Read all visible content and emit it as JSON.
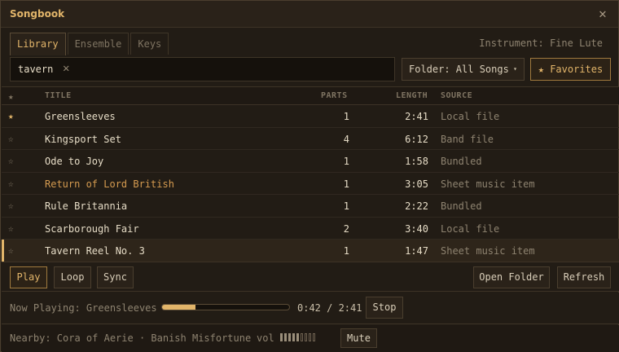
{
  "window": {
    "title": "Songbook",
    "close_icon": "close-icon"
  },
  "tabs": [
    {
      "label": "Library",
      "active": true
    },
    {
      "label": "Ensemble",
      "active": false
    },
    {
      "label": "Keys",
      "active": false
    }
  ],
  "instrument": "Instrument: Fine Lute",
  "search": {
    "value": "tavern",
    "placeholder": ""
  },
  "folder": {
    "label": "Folder: All Songs",
    "caret": "▾"
  },
  "favorites_button": "★ Favorites",
  "columns": {
    "star": "★",
    "title": "TITLE",
    "parts": "PARTS",
    "length": "LENGTH",
    "source": "SOURCE"
  },
  "songs": [
    {
      "fav": true,
      "star": "★",
      "title": "Greensleeves",
      "parts": "1",
      "length": "2:41",
      "source": "Local file"
    },
    {
      "fav": false,
      "star": "☆",
      "title": "Kingsport Set",
      "parts": "4",
      "length": "6:12",
      "source": "Band file"
    },
    {
      "fav": false,
      "star": "☆",
      "title": "Ode to Joy",
      "parts": "1",
      "length": "1:58",
      "source": "Bundled"
    },
    {
      "fav": false,
      "star": "☆",
      "title": "Return of Lord British",
      "parts": "1",
      "length": "3:05",
      "source": "Sheet music item",
      "highlight": true
    },
    {
      "fav": false,
      "star": "☆",
      "title": "Rule Britannia",
      "parts": "1",
      "length": "2:22",
      "source": "Bundled"
    },
    {
      "fav": false,
      "star": "☆",
      "title": "Scarborough Fair",
      "parts": "2",
      "length": "3:40",
      "source": "Local file"
    },
    {
      "fav": false,
      "star": "☆",
      "title": "Tavern Reel No. 3",
      "parts": "1",
      "length": "1:47",
      "source": "Sheet music item",
      "selected": true
    }
  ],
  "actions": {
    "play": "Play",
    "loop": "Loop",
    "sync": "Sync",
    "open_folder": "Open Folder",
    "refresh": "Refresh"
  },
  "now_playing": {
    "label": "Now Playing: Greensleeves",
    "time": "0:42 / 2:41",
    "progress": 0.26,
    "stop": "Stop"
  },
  "status": {
    "nearby": "Nearby: Cora of Aerie · Banish Misfortune",
    "vol_label": "vol",
    "volume_level": 5,
    "volume_max": 9,
    "mute": "Mute"
  },
  "colors": {
    "accent": "#e2b56a",
    "highlight_title": "#d59b50",
    "background": "#221c15"
  }
}
